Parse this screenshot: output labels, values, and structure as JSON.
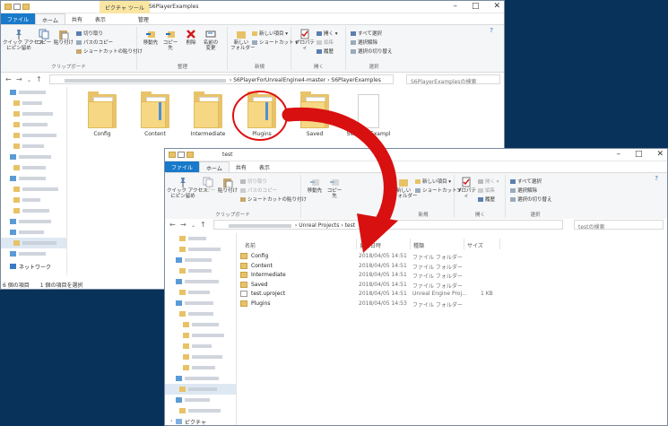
{
  "w1": {
    "title": "S6PlayerExamples",
    "context_tab": "ピクチャ ツール",
    "tabs": [
      "ファイル",
      "ホーム",
      "共有",
      "表示",
      "管理"
    ],
    "ribbon": {
      "pin": "クイック アクセス\nにピン留め",
      "copy": "コピー",
      "paste": "貼り付け",
      "cut": "切り取り",
      "copypath": "パスのコピー",
      "pasteshortcut": "ショートカットの貼り付け",
      "moveto": "移動先",
      "copyto": "コピー先",
      "delete": "削除",
      "rename": "名前の\n変更",
      "newfolder": "新しい\nフォルダー",
      "newitem": "新しい項目 ▾",
      "shortcut": "ショートカット ▾",
      "props": "プロパティ",
      "open": "開く ▾",
      "edit": "編集",
      "history": "履歴",
      "selall": "すべて選択",
      "selnone": "選択解除",
      "selinv": "選択の切り替え",
      "g_clip": "クリップボード",
      "g_org": "整理",
      "g_new": "新規",
      "g_open": "開く",
      "g_sel": "選択"
    },
    "path": [
      "S6PlayerForUnrealEngine4-master",
      "S6PlayerExamples"
    ],
    "search_placeholder": "S6PlayerExamplesの検索",
    "items": [
      "Config",
      "Content",
      "Intermediate",
      "Plugins",
      "Saved",
      "S6PlayerExampl"
    ],
    "network": "ネットワーク",
    "status": "6 個の項目　　1 個の項目を選択"
  },
  "w2": {
    "title": "test",
    "tabs": [
      "ファイル",
      "ホーム",
      "共有",
      "表示"
    ],
    "path": [
      "Unreal Projects",
      "test"
    ],
    "search_placeholder": "testの検索",
    "headers": {
      "name": "名前",
      "date": "更新日時",
      "type": "種類",
      "size": "サイズ"
    },
    "rows": [
      {
        "name": "Config",
        "date": "2018/04/05 14:51",
        "type": "ファイル フォルダー",
        "size": "",
        "kind": "folder"
      },
      {
        "name": "Content",
        "date": "2018/04/05 14:51",
        "type": "ファイル フォルダー",
        "size": "",
        "kind": "folder"
      },
      {
        "name": "Intermediate",
        "date": "2018/04/05 14:51",
        "type": "ファイル フォルダー",
        "size": "",
        "kind": "folder"
      },
      {
        "name": "Saved",
        "date": "2018/04/05 14:51",
        "type": "ファイル フォルダー",
        "size": "",
        "kind": "folder"
      },
      {
        "name": "test.uproject",
        "date": "2018/04/05 14:51",
        "type": "Unreal Engine Proj...",
        "size": "1 KB",
        "kind": "doc"
      },
      {
        "name": "Plugins",
        "date": "2018/04/05 14:53",
        "type": "ファイル フォルダー",
        "size": "",
        "kind": "folder"
      }
    ],
    "pictures": "ピクチャ"
  },
  "colors": {
    "file_tab": "#1979ca",
    "annotation": "#e01010",
    "desktop": "#08325a"
  }
}
